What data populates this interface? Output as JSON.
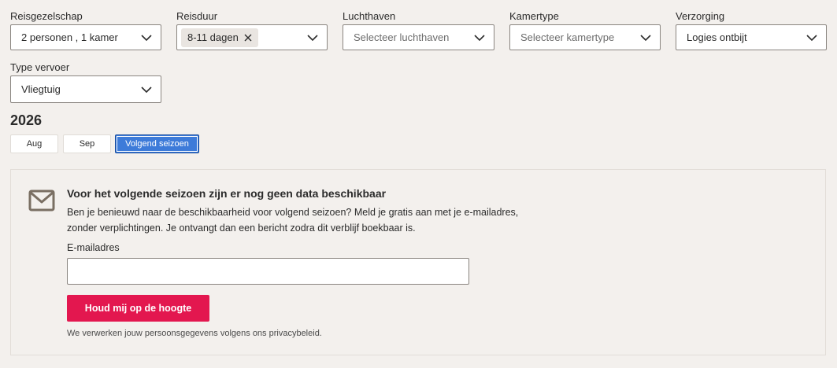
{
  "filters": [
    {
      "label": "Reisgezelschap",
      "value": "2 personen , 1 kamer",
      "placeholder": ""
    },
    {
      "label": "Reisduur",
      "value": "",
      "placeholder": "",
      "chip": "8-11 dagen"
    },
    {
      "label": "Luchthaven",
      "value": "",
      "placeholder": "Selecteer luchthaven"
    },
    {
      "label": "Kamertype",
      "value": "",
      "placeholder": "Selecteer kamertype"
    },
    {
      "label": "Verzorging",
      "value": "Logies ontbijt",
      "placeholder": ""
    },
    {
      "label": "Type vervoer",
      "value": "Vliegtuig",
      "placeholder": ""
    }
  ],
  "calendar": {
    "year": "2026",
    "months": [
      "Aug",
      "Sep",
      "Volgend seizoen"
    ],
    "active_month": "Volgend seizoen"
  },
  "notice": {
    "icon": "mail-icon",
    "title": "Voor het volgende seizoen zijn er nog geen data beschikbaar",
    "text": "Ben je benieuwd naar de beschikbaarheid voor volgend seizoen? Meld je gratis aan met je e-mailadres, zonder verplichtingen. Je ontvangt dan een bericht zodra dit verblijf boekbaar is.",
    "email_label": "E-mailadres",
    "email_value": "",
    "button_label": "Houd mij op de hoogte",
    "privacy_text": "We verwerken jouw persoonsgegevens volgens ons privacybeleid."
  },
  "colors": {
    "background": "#f3f0ed",
    "accent": "#e3174f",
    "active_tab": "#3d7bd9"
  }
}
